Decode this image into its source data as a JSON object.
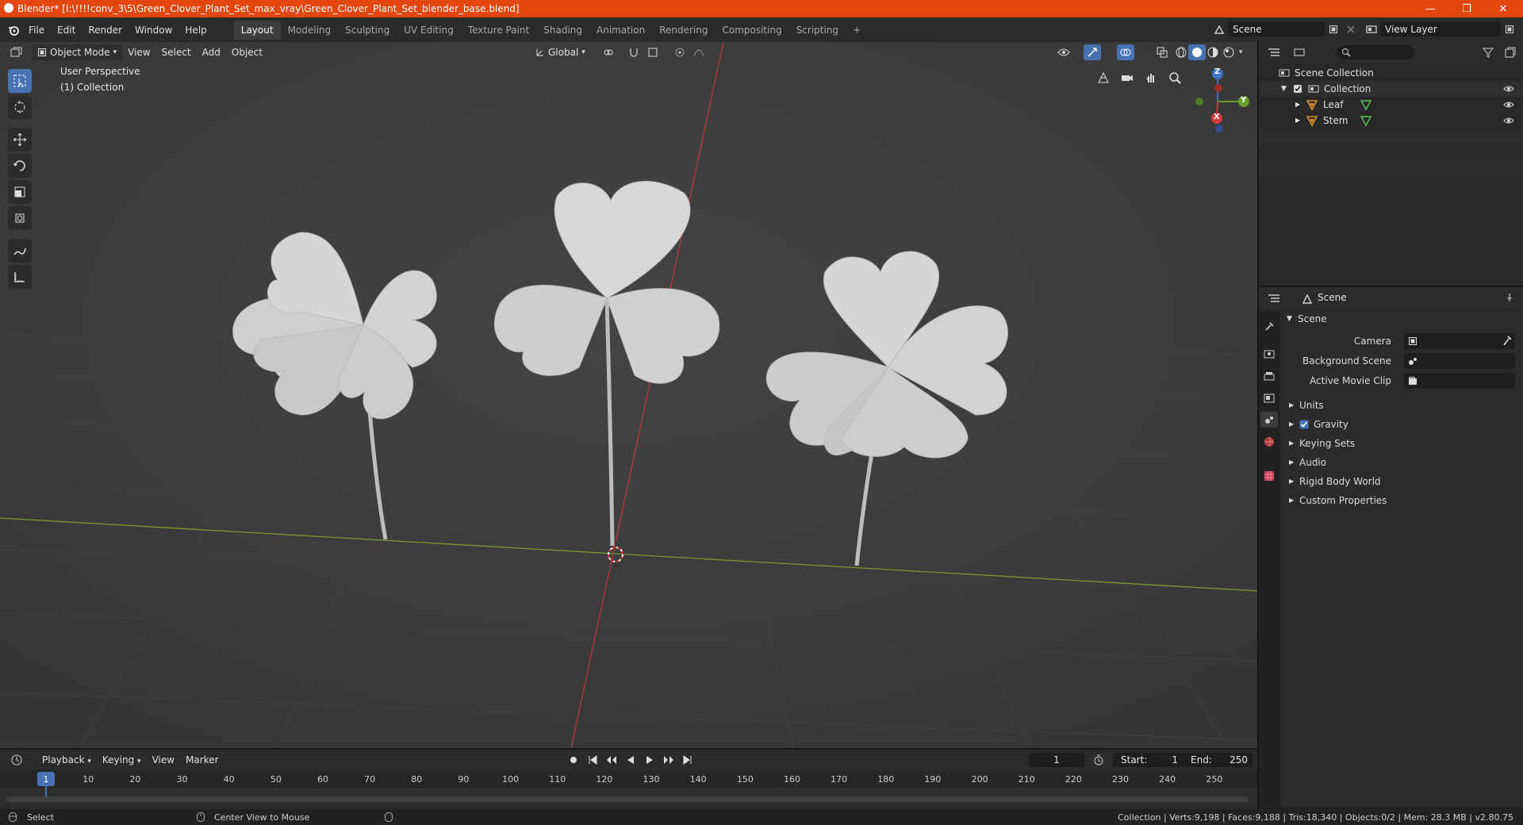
{
  "window": {
    "title": "Blender* [I:\\!!!!conv_3\\5\\Green_Clover_Plant_Set_max_vray\\Green_Clover_Plant_Set_blender_base.blend]",
    "minimize": "—",
    "maximize": "❐",
    "close": "✕"
  },
  "menubar": {
    "items": [
      "File",
      "Edit",
      "Render",
      "Window",
      "Help"
    ],
    "workspaces": [
      "Layout",
      "Modeling",
      "Sculpting",
      "UV Editing",
      "Texture Paint",
      "Shading",
      "Animation",
      "Rendering",
      "Compositing",
      "Scripting"
    ],
    "add_workspace": "+",
    "scene": "Scene",
    "view_layer": "View Layer"
  },
  "viewport": {
    "mode": "Object Mode",
    "menus": [
      "View",
      "Select",
      "Add",
      "Object"
    ],
    "orientation": "Global",
    "overlay_line1": "User Perspective",
    "overlay_line2": "(1) Collection",
    "gizmo": {
      "x": "X",
      "y": "Y",
      "z": "Z"
    }
  },
  "outliner": {
    "search_placeholder": "",
    "root": "Scene Collection",
    "collection": "Collection",
    "objects": [
      "Leaf",
      "Stem"
    ]
  },
  "properties": {
    "header": "Scene",
    "panel": "Scene",
    "fields": [
      {
        "label": "Camera"
      },
      {
        "label": "Background Scene"
      },
      {
        "label": "Active Movie Clip"
      }
    ],
    "sections": [
      "Units",
      "Gravity",
      "Keying Sets",
      "Audio",
      "Rigid Body World",
      "Custom Properties"
    ]
  },
  "timeline": {
    "menus": [
      "Playback",
      "Keying",
      "View",
      "Marker"
    ],
    "current_frame": "1",
    "start_label": "Start:",
    "start": "1",
    "end_label": "End:",
    "end": "250",
    "ticks": [
      "1",
      "10",
      "20",
      "30",
      "40",
      "50",
      "60",
      "70",
      "80",
      "90",
      "100",
      "110",
      "120",
      "130",
      "140",
      "150",
      "160",
      "170",
      "180",
      "190",
      "200",
      "210",
      "220",
      "230",
      "240",
      "250"
    ]
  },
  "statusbar": {
    "left": "Select",
    "middle": "Center View to Mouse",
    "right": "Collection | Verts:9,198 | Faces:9,188 | Tris:18,340 | Objects:0/2 | Mem: 28.3 MB | v2.80.75"
  },
  "colors": {
    "titlebar": "#e4460f",
    "accent": "#4772b3",
    "x_axis": "#c43c3c",
    "y_axis": "#7a9a2a",
    "object_orange": "#e0902a",
    "mesh_green": "#5ec462"
  }
}
